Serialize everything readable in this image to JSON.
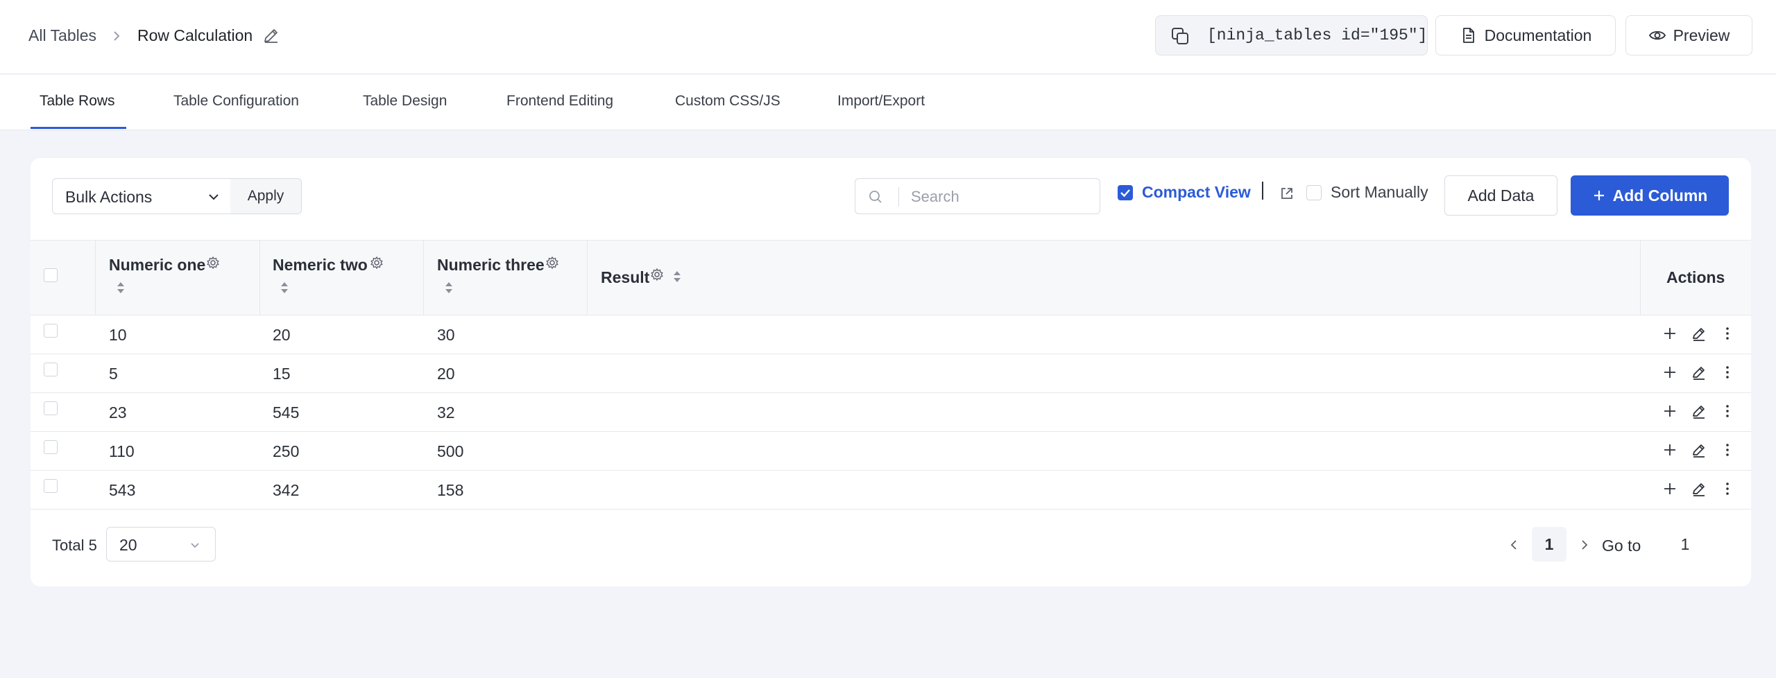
{
  "breadcrumb": {
    "root": "All Tables",
    "current": "Row Calculation"
  },
  "header": {
    "shortcode": "[ninja_tables id=\"195\"]",
    "documentation_label": "Documentation",
    "preview_label": "Preview"
  },
  "tabs": [
    {
      "label": "Table Rows",
      "active": true
    },
    {
      "label": "Table Configuration"
    },
    {
      "label": "Table Design"
    },
    {
      "label": "Frontend Editing"
    },
    {
      "label": "Custom CSS/JS"
    },
    {
      "label": "Import/Export"
    }
  ],
  "toolbar": {
    "bulk_actions": "Bulk Actions",
    "apply": "Apply",
    "search_placeholder": "Search",
    "compact_view": "Compact View",
    "compact_view_checked": true,
    "sort_manually": "Sort Manually",
    "sort_manually_checked": false,
    "add_data": "Add Data",
    "add_column": "Add Column"
  },
  "table": {
    "columns": [
      "Numeric one",
      "Nemeric two",
      "Numeric three",
      "Result"
    ],
    "actions_header": "Actions",
    "rows": [
      [
        "10",
        "20",
        "30",
        ""
      ],
      [
        "5",
        "15",
        "20",
        ""
      ],
      [
        "23",
        "545",
        "32",
        ""
      ],
      [
        "110",
        "250",
        "500",
        ""
      ],
      [
        "543",
        "342",
        "158",
        ""
      ]
    ]
  },
  "pagination": {
    "total_label": "Total 5",
    "page_size": "20",
    "current_page": "1",
    "goto_label": "Go to",
    "goto_value": "1"
  },
  "colors": {
    "accent": "#2b5bd7",
    "background": "#f3f4fa"
  }
}
